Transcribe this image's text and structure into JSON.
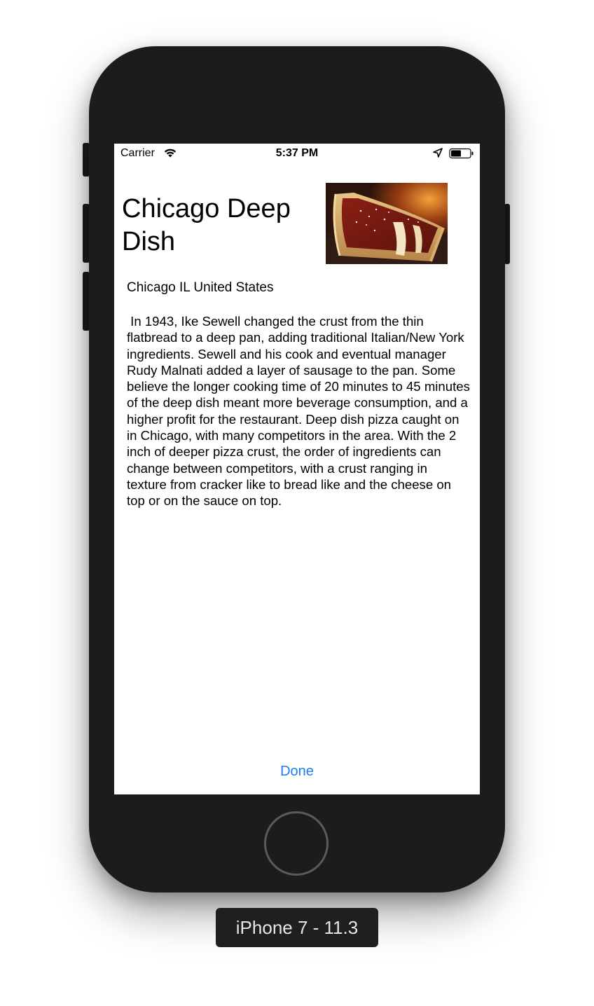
{
  "status_bar": {
    "carrier": "Carrier",
    "time": "5:37 PM",
    "icons": [
      "wifi-icon",
      "location-arrow-icon",
      "battery-icon"
    ]
  },
  "detail": {
    "title": "Chicago Deep Dish",
    "image": "deep-dish-pizza-photo",
    "location": "Chicago IL United States",
    "description": " In 1943, Ike Sewell changed the crust from the thin flatbread to a deep pan, adding traditional Italian/New York  ingredients. Sewell and his cook and eventual manager Rudy Malnati added a layer of sausage to the pan. Some believe the longer cooking time of 20 minutes to 45 minutes of the deep dish meant more beverage consumption, and a higher profit for the restaurant. Deep dish pizza caught on in Chicago, with many competitors in the area. With the 2 inch of deeper pizza crust, the order of ingredients can change between competitors, with a crust ranging in texture from cracker like to bread like and the cheese on top or on the sauce on top.",
    "done_label": "Done"
  },
  "device_label": "iPhone 7 - 11.3",
  "colors": {
    "accent": "#1a7ff2",
    "device_body": "#1c1c1c"
  }
}
